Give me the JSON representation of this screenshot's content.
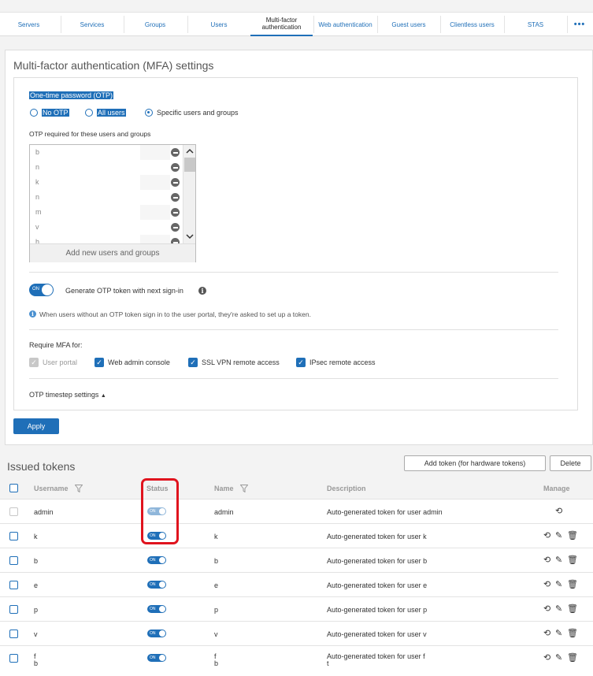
{
  "tabs": [
    {
      "label": "Servers"
    },
    {
      "label": "Services"
    },
    {
      "label": "Groups"
    },
    {
      "label": "Users"
    },
    {
      "label": "Multi-factor authentication",
      "active": true
    },
    {
      "label": "Web authentication"
    },
    {
      "label": "Guest users"
    },
    {
      "label": "Clientless users"
    },
    {
      "label": "STAS"
    }
  ],
  "more_icon": "more-dots-icon",
  "mfa": {
    "title": "Multi-factor authentication (MFA) settings",
    "otp_heading": "One-time password (OTP)",
    "radios": [
      {
        "label": "No OTP",
        "selected": false
      },
      {
        "label": "All users",
        "selected": false
      },
      {
        "label": "Specific users and groups",
        "selected": true
      }
    ],
    "required_label": "OTP required for these users and groups",
    "list_items": [
      "b",
      "n",
      "k",
      "n",
      "m",
      "v",
      "h"
    ],
    "add_users_label": "Add new users and groups",
    "generate_toggle": {
      "state": "ON"
    },
    "generate_label": "Generate OTP token with next sign-in",
    "info_text": "When users without an OTP token sign in to the user portal, they're asked to set up a token.",
    "require_label": "Require MFA for:",
    "require_options": [
      {
        "label": "User portal",
        "checked": true,
        "disabled": true
      },
      {
        "label": "Web admin console",
        "checked": true,
        "disabled": false
      },
      {
        "label": "SSL VPN remote access",
        "checked": true,
        "disabled": false
      },
      {
        "label": "IPsec remote access",
        "checked": true,
        "disabled": false
      }
    ],
    "timestep_label": "OTP timestep settings",
    "apply_label": "Apply"
  },
  "tokens": {
    "title": "Issued tokens",
    "add_token_label": "Add token (for hardware tokens)",
    "delete_label": "Delete",
    "columns": {
      "username": "Username",
      "status": "Status",
      "name": "Name",
      "description": "Description",
      "manage": "Manage"
    },
    "rows": [
      {
        "username": "admin",
        "status": "ON",
        "name": "admin",
        "description": "Auto-generated token for user admin",
        "disabled": true
      },
      {
        "username": "k",
        "status": "ON",
        "name": "k",
        "description": "Auto-generated token for user k"
      },
      {
        "username": "b",
        "status": "ON",
        "name": "b",
        "description": "Auto-generated token for user b"
      },
      {
        "username": "e",
        "status": "ON",
        "name": "e",
        "description": "Auto-generated token for user e"
      },
      {
        "username": "p",
        "status": "ON",
        "name": "p",
        "description": "Auto-generated token for user p"
      },
      {
        "username": "v",
        "status": "ON",
        "name": "v",
        "description": "Auto-generated token for user v"
      },
      {
        "username": "f",
        "username2": "b",
        "status": "ON",
        "name": "f",
        "name2": "b",
        "description": "Auto-generated token for user f",
        "description2": "t"
      }
    ]
  },
  "colors": {
    "accent": "#1f6fb8",
    "highlight_box": "#e0141e"
  }
}
